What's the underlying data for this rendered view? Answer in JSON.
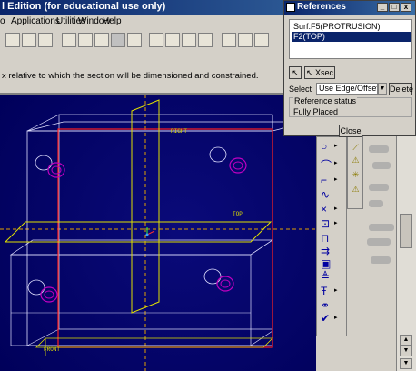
{
  "app": {
    "title": "l Edition (for educational use only)"
  },
  "menubar": {
    "items": [
      "o",
      "Applications",
      "Utilities",
      "Window",
      "Help"
    ]
  },
  "message": {
    "text": "x relative to which the section will be dimensioned and constrained."
  },
  "references_dialog": {
    "title": "References",
    "window_buttons": [
      "_",
      "□",
      "x"
    ],
    "references": [
      {
        "label": "Surf:F5(PROTRUSION)",
        "selected": false
      },
      {
        "label": "F2(TOP)",
        "selected": true
      }
    ],
    "pick_button": "↖",
    "sec_button": "↖ Xsec",
    "select_label": "Select",
    "select_value": "Use Edge/Offset",
    "delete_button": "Delete",
    "status_header": "Reference status",
    "status_value": "Fully Placed",
    "close_button": "Close"
  },
  "viewport": {
    "datum_labels": {
      "right": "RIGHT",
      "top": "TOP",
      "front": "FRONT"
    },
    "colors": {
      "background": "#000060",
      "part_edges": "#e0e0ff",
      "datum": "#e0e000",
      "section_outline": "#ff2020",
      "holes": "#c000c0"
    }
  },
  "sketcher_toolbar": {
    "icons": [
      "circle-icon",
      "arc-icon",
      "fillet-icon",
      "spline-icon",
      "point-icon",
      "coordinate-system-icon",
      "use-edge-icon",
      "dimension-icon",
      "modify-icon",
      "constraints-icon",
      "text-icon",
      "palette-icon",
      "trim-icon",
      "done-icon"
    ],
    "glyphs": [
      "○",
      "⌒",
      "⌐",
      "∿",
      "×",
      "⊡",
      "⊓",
      "⇉",
      "▣",
      "≜",
      "Ŧ",
      "⚭",
      "⧾",
      "✔"
    ]
  }
}
